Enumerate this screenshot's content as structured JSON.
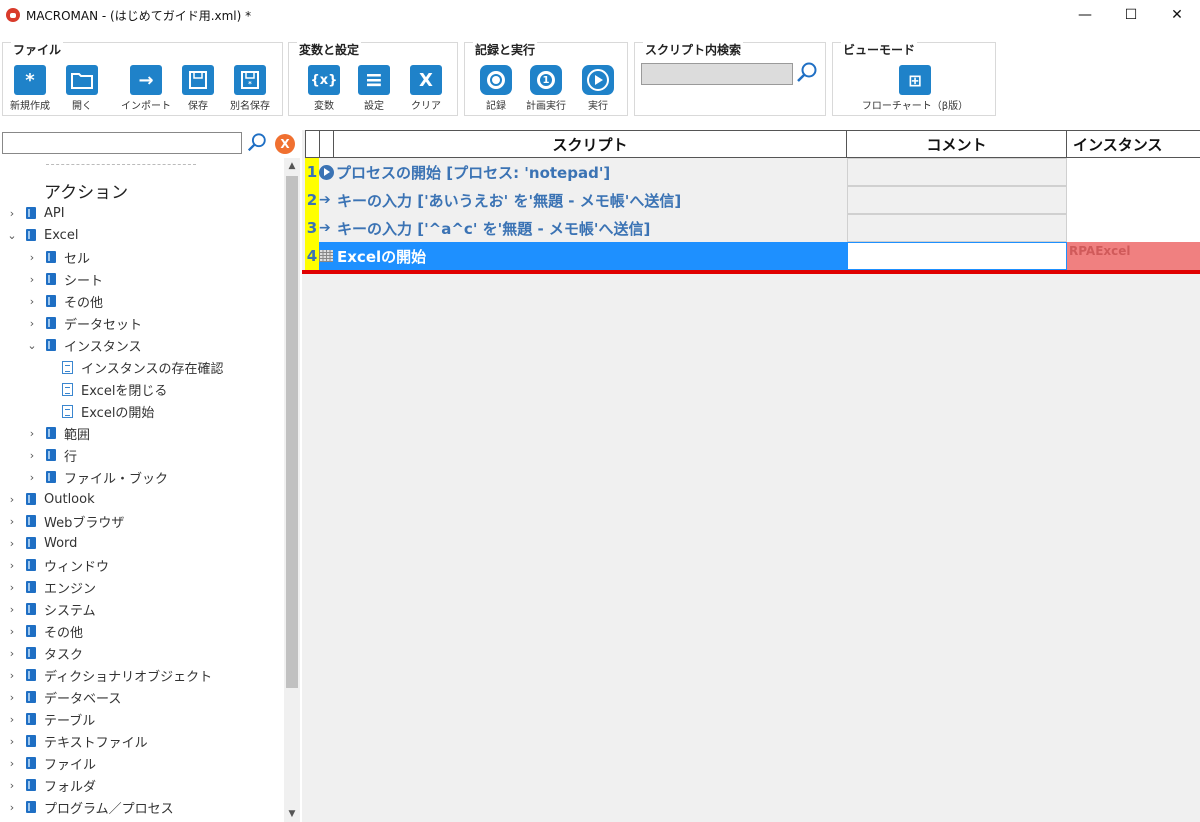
{
  "window": {
    "title": "MACROMAN - (はじめてガイド用.xml) *",
    "controls": {
      "minimize": "—",
      "maximize": "☐",
      "close": "✕"
    }
  },
  "ribbon": {
    "groups": {
      "file": {
        "title": "ファイル",
        "buttons": [
          {
            "label": "新規作成",
            "icon": "new-icon",
            "glyph": "*"
          },
          {
            "label": "開く",
            "icon": "folder-icon",
            "glyph": ""
          },
          {
            "label": "インポート",
            "icon": "import-icon",
            "glyph": "→"
          },
          {
            "label": "保存",
            "icon": "save-icon",
            "glyph": ""
          },
          {
            "label": "別名保存",
            "icon": "save-as-icon",
            "glyph": ""
          }
        ]
      },
      "vars": {
        "title": "変数と設定",
        "buttons": [
          {
            "label": "変数",
            "icon": "variable-icon",
            "glyph": "{x}"
          },
          {
            "label": "設定",
            "icon": "settings-list-icon",
            "glyph": "≡"
          },
          {
            "label": "クリア",
            "icon": "clear-x-icon",
            "glyph": "X"
          }
        ]
      },
      "record": {
        "title": "記録と実行",
        "buttons": [
          {
            "label": "記録",
            "icon": "record-icon"
          },
          {
            "label": "計画実行",
            "icon": "schedule-icon",
            "glyph": "1"
          },
          {
            "label": "実行",
            "icon": "play-icon"
          }
        ]
      },
      "search": {
        "title": "スクリプト内検索",
        "value": ""
      },
      "view": {
        "title": "ビューモード",
        "buttons": [
          {
            "label": "フローチャート（β版）",
            "icon": "flowchart-icon",
            "glyph": "⊞"
          }
        ]
      }
    }
  },
  "left_panel": {
    "search_value": "",
    "clear_label": "X",
    "header": "アクション",
    "tree": [
      {
        "label": "API",
        "level": 0,
        "type": "folder",
        "expanded": false
      },
      {
        "label": "Excel",
        "level": 0,
        "type": "folder",
        "expanded": true
      },
      {
        "label": "セル",
        "level": 1,
        "type": "folder",
        "expanded": false
      },
      {
        "label": "シート",
        "level": 1,
        "type": "folder",
        "expanded": false
      },
      {
        "label": "その他",
        "level": 1,
        "type": "folder",
        "expanded": false
      },
      {
        "label": "データセット",
        "level": 1,
        "type": "folder",
        "expanded": false
      },
      {
        "label": "インスタンス",
        "level": 1,
        "type": "folder",
        "expanded": true
      },
      {
        "label": "インスタンスの存在確認",
        "level": 2,
        "type": "doc"
      },
      {
        "label": "Excelを閉じる",
        "level": 2,
        "type": "doc"
      },
      {
        "label": "Excelの開始",
        "level": 2,
        "type": "doc"
      },
      {
        "label": "範囲",
        "level": 1,
        "type": "folder",
        "expanded": false
      },
      {
        "label": "行",
        "level": 1,
        "type": "folder",
        "expanded": false
      },
      {
        "label": "ファイル・ブック",
        "level": 1,
        "type": "folder",
        "expanded": false
      },
      {
        "label": "Outlook",
        "level": 0,
        "type": "folder",
        "expanded": false
      },
      {
        "label": "Webブラウザ",
        "level": 0,
        "type": "folder",
        "expanded": false
      },
      {
        "label": "Word",
        "level": 0,
        "type": "folder",
        "expanded": false
      },
      {
        "label": "ウィンドウ",
        "level": 0,
        "type": "folder",
        "expanded": false
      },
      {
        "label": "エンジン",
        "level": 0,
        "type": "folder",
        "expanded": false
      },
      {
        "label": "システム",
        "level": 0,
        "type": "folder",
        "expanded": false
      },
      {
        "label": "その他",
        "level": 0,
        "type": "folder",
        "expanded": false
      },
      {
        "label": "タスク",
        "level": 0,
        "type": "folder",
        "expanded": false
      },
      {
        "label": "ディクショナリオブジェクト",
        "level": 0,
        "type": "folder",
        "expanded": false
      },
      {
        "label": "データベース",
        "level": 0,
        "type": "folder",
        "expanded": false
      },
      {
        "label": "テーブル",
        "level": 0,
        "type": "folder",
        "expanded": false
      },
      {
        "label": "テキストファイル",
        "level": 0,
        "type": "folder",
        "expanded": false
      },
      {
        "label": "ファイル",
        "level": 0,
        "type": "folder",
        "expanded": false
      },
      {
        "label": "フォルダ",
        "level": 0,
        "type": "folder",
        "expanded": false
      },
      {
        "label": "プログラム／プロセス",
        "level": 0,
        "type": "folder",
        "expanded": false
      }
    ]
  },
  "grid": {
    "columns": {
      "script": "スクリプト",
      "comment": "コメント",
      "instance": "インスタンス"
    },
    "rows": [
      {
        "num": "1",
        "icon": "process-start-icon",
        "text": "プロセスの開始 [プロセス: 'notepad']",
        "comment": "",
        "instance": ""
      },
      {
        "num": "2",
        "icon": "arrow-icon",
        "text": "キーの入力 ['あいうえお' を'無題 - メモ帳'へ送信]",
        "comment": "",
        "instance": ""
      },
      {
        "num": "3",
        "icon": "arrow-icon",
        "text": "キーの入力 ['^a^c' を'無題 - メモ帳'へ送信]",
        "comment": "",
        "instance": ""
      },
      {
        "num": "4",
        "icon": "excel-grid-icon",
        "text": "Excelの開始",
        "comment": "",
        "instance": "RPAExcel",
        "selected": true
      }
    ]
  },
  "colors": {
    "accent": "#1f82c9",
    "selection": "#1e90ff",
    "row_number_bg": "#ffff00",
    "instance_highlight": "#f08080",
    "drop_line": "#e00000",
    "script_text": "#3b73b4"
  }
}
